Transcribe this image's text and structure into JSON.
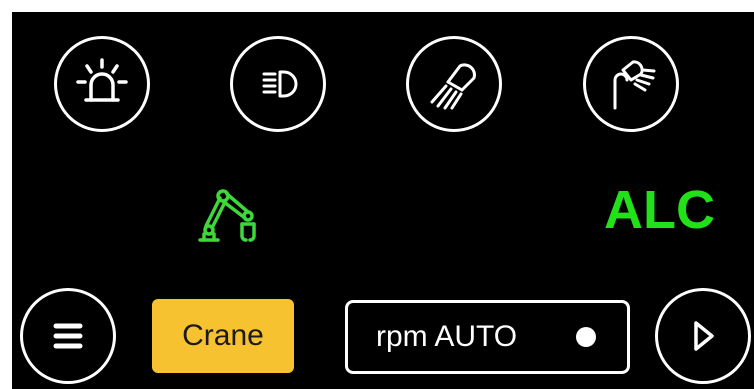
{
  "top_buttons": [
    {
      "icon": "beacon-light-icon"
    },
    {
      "icon": "low-beam-headlight-icon"
    },
    {
      "icon": "work-light-icon"
    },
    {
      "icon": "spotlight-icon"
    }
  ],
  "status": {
    "crane_icon": "crane-arm-icon",
    "crane_icon_color": "#3fd83a",
    "mode_label": "ALC",
    "mode_label_color": "#22e01a"
  },
  "bottom_bar": {
    "menu_icon": "hamburger-menu-icon",
    "crane_button_label": "Crane",
    "crane_button_color": "#f6c230",
    "rpm_button_label": "rpm AUTO",
    "rpm_indicator": "on",
    "next_icon": "play-next-icon"
  }
}
